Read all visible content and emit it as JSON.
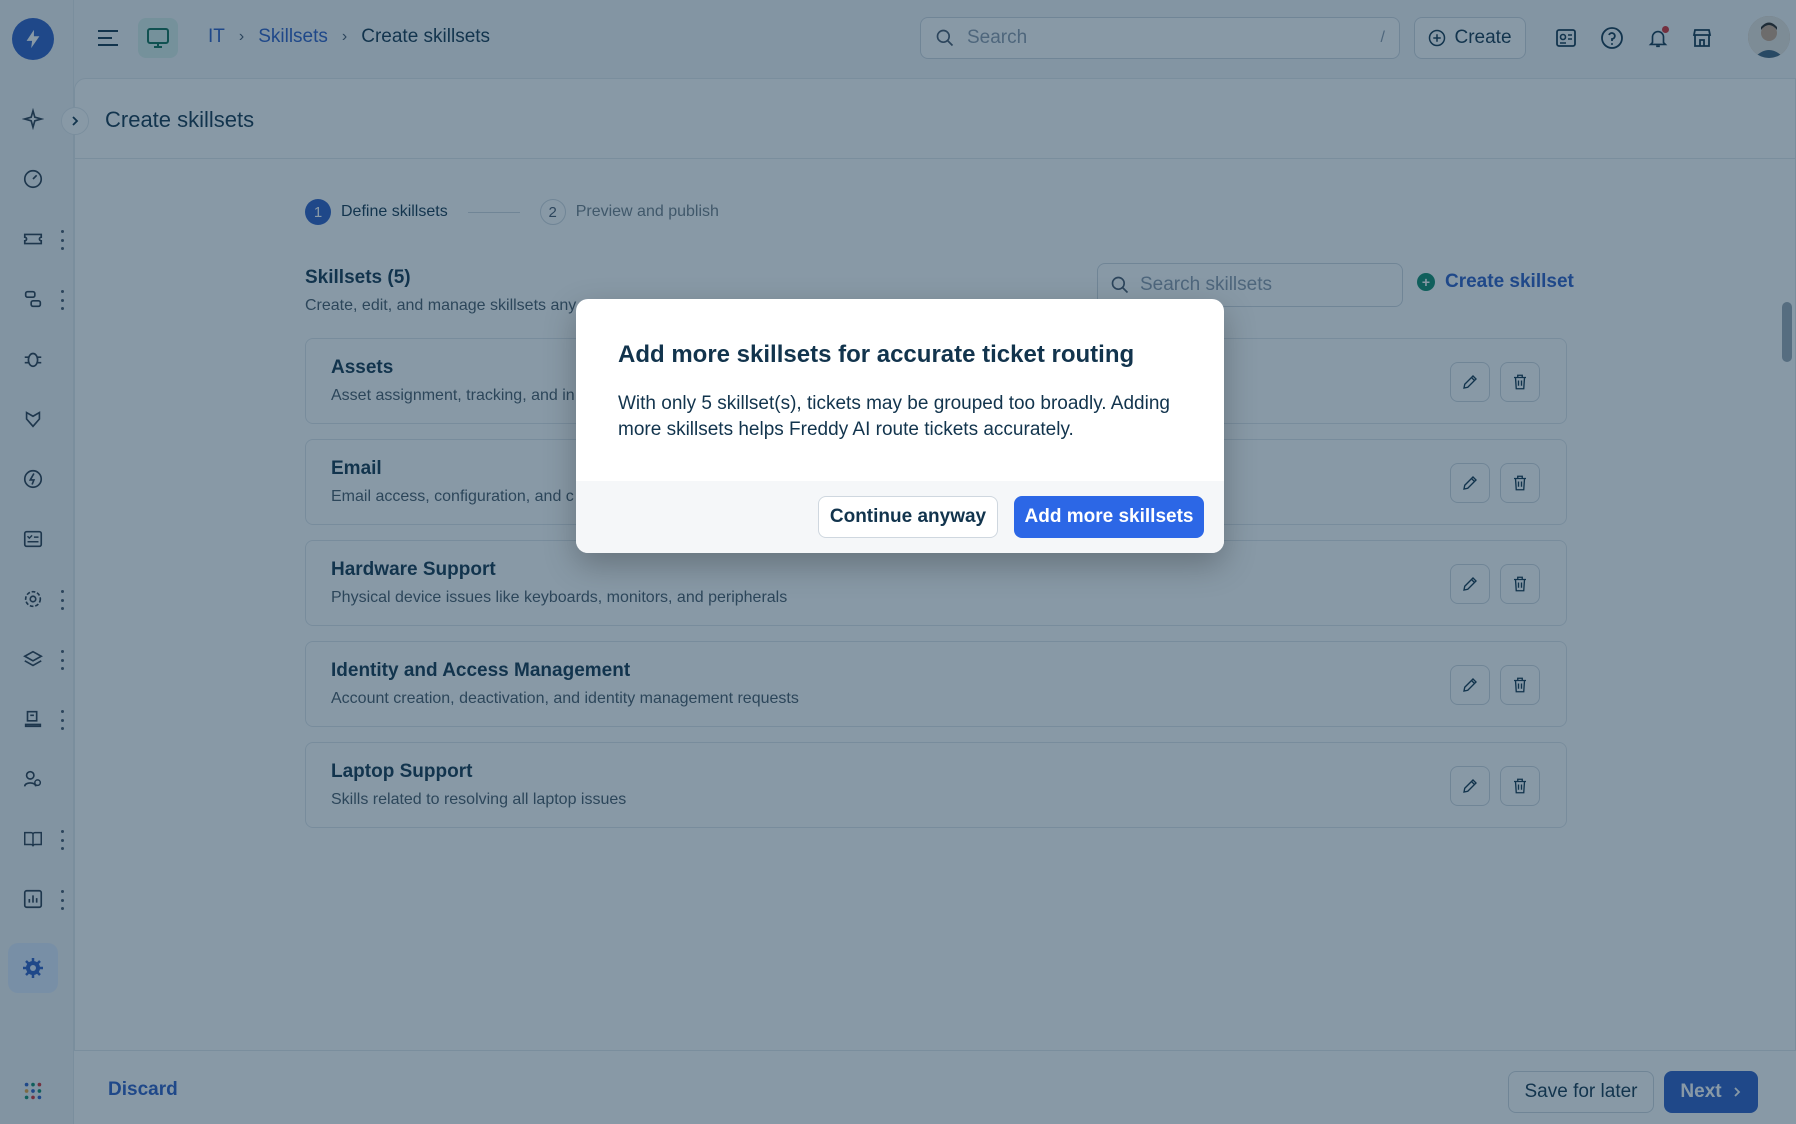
{
  "topbar": {
    "breadcrumbs": [
      "IT",
      "Skillsets",
      "Create skillsets"
    ],
    "search_placeholder": "Search",
    "search_shortcut": "/",
    "create_label": "Create"
  },
  "page": {
    "title": "Create skillsets"
  },
  "stepper": [
    {
      "num": "1",
      "label": "Define skillsets",
      "active": true
    },
    {
      "num": "2",
      "label": "Preview and publish",
      "active": false
    }
  ],
  "skillsets": {
    "heading": "Skillsets (5)",
    "subheading": "Create, edit, and manage skillsets any",
    "search_placeholder": "Search skillsets",
    "create_label": "Create skillset",
    "items": [
      {
        "name": "Assets",
        "desc": "Asset assignment, tracking, and in"
      },
      {
        "name": "Email",
        "desc": "Email access, configuration, and c"
      },
      {
        "name": "Hardware Support",
        "desc": "Physical device issues like keyboards, monitors, and peripherals"
      },
      {
        "name": "Identity and Access Management",
        "desc": "Account creation, deactivation, and identity management requests"
      },
      {
        "name": "Laptop Support",
        "desc": "Skills related to resolving all laptop issues"
      }
    ]
  },
  "footer": {
    "discard": "Discard",
    "save_later": "Save for later",
    "next": "Next"
  },
  "modal": {
    "title": "Add more skillsets for accurate ticket routing",
    "body": "With only 5 skillset(s), tickets may be grouped too broadly. Adding more skillsets helps Freddy AI route tickets accurately.",
    "secondary": "Continue anyway",
    "primary": "Add more skillsets"
  },
  "colors": {
    "brand": "#2c5cc5",
    "primary_button": "#2c67e6",
    "overlay": "rgba(18,52,77,0.5)"
  }
}
